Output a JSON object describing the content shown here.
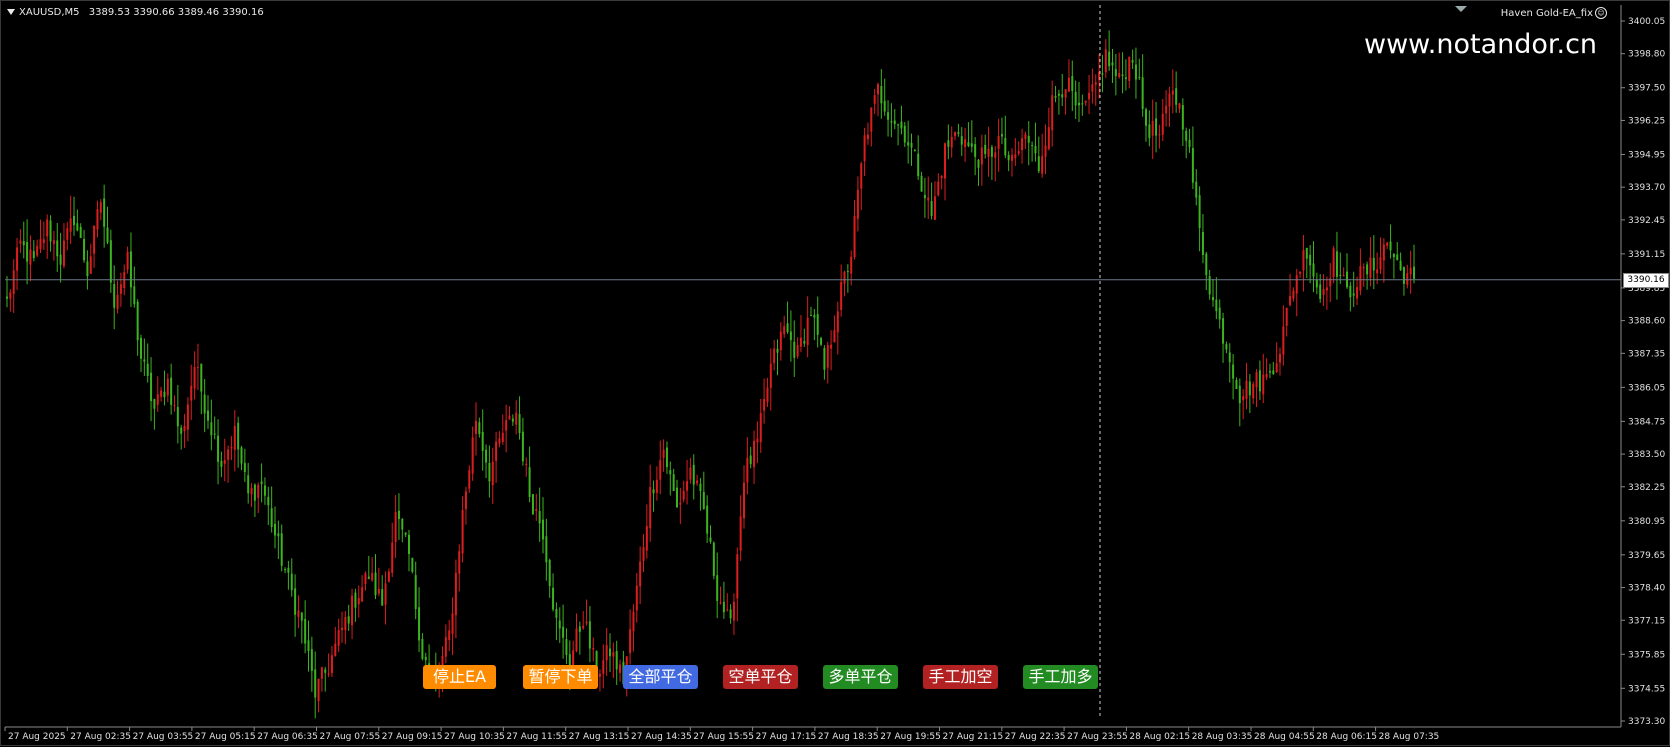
{
  "chart": {
    "symbol": "XAUUSD,M5",
    "ohlc": "3389.53 3390.66 3389.46 3390.16",
    "ea_label": "Haven Gold-EA_fix",
    "watermark": "www.notandor.cn",
    "current_price": "3390.16"
  },
  "buttons": [
    {
      "label": "停止EA",
      "color": "#ff8c00"
    },
    {
      "label": "暂停下单",
      "color": "#ff8c00"
    },
    {
      "label": "全部平仓",
      "color": "#4169e1"
    },
    {
      "label": "空单平仓",
      "color": "#b22222"
    },
    {
      "label": "多单平仓",
      "color": "#228b22"
    },
    {
      "label": "手工加空",
      "color": "#b22222"
    },
    {
      "label": "手工加多",
      "color": "#228b22"
    }
  ],
  "colors": {
    "bull": "#dc1e1e",
    "bear": "#3cb41e",
    "grid_line": "#6a7a8a",
    "axis_text": "#e0e0e0"
  },
  "chart_data": {
    "type": "candlestick",
    "x_tick_labels": [
      "27 Aug 2025",
      "27 Aug 02:35",
      "27 Aug 03:55",
      "27 Aug 05:15",
      "27 Aug 06:35",
      "27 Aug 07:55",
      "27 Aug 09:15",
      "27 Aug 10:35",
      "27 Aug 11:55",
      "27 Aug 13:15",
      "27 Aug 14:35",
      "27 Aug 15:55",
      "27 Aug 17:15",
      "27 Aug 18:35",
      "27 Aug 19:55",
      "27 Aug 21:15",
      "27 Aug 22:35",
      "27 Aug 23:55",
      "28 Aug 02:15",
      "28 Aug 03:35",
      "28 Aug 04:55",
      "28 Aug 06:15",
      "28 Aug 07:35"
    ],
    "y_tick_labels": [
      "3400.05",
      "3398.80",
      "3397.50",
      "3396.25",
      "3394.95",
      "3393.70",
      "3392.45",
      "3391.15",
      "3389.85",
      "3388.60",
      "3387.35",
      "3386.05",
      "3384.75",
      "3383.50",
      "3382.25",
      "3380.95",
      "3379.65",
      "3378.40",
      "3377.15",
      "3375.85",
      "3374.55",
      "3373.30"
    ],
    "ylim": [
      3373.3,
      3400.05
    ],
    "current_price": 3390.16,
    "close_path": [
      3389.3,
      3391.5,
      3390.8,
      3392.2,
      3391.0,
      3392.6,
      3390.5,
      3393.2,
      3389.4,
      3390.8,
      3387.2,
      3385.2,
      3386.3,
      3384.1,
      3386.9,
      3385.0,
      3383.2,
      3384.3,
      3381.9,
      3382.4,
      3380.4,
      3378.6,
      3377.0,
      3374.4,
      3375.4,
      3376.8,
      3378.0,
      3378.9,
      3377.8,
      3381.1,
      3379.6,
      3375.9,
      3374.7,
      3376.6,
      3381.2,
      3384.9,
      3382.8,
      3384.3,
      3385.1,
      3382.0,
      3380.6,
      3377.0,
      3375.6,
      3377.3,
      3375.1,
      3376.0,
      3374.9,
      3378.3,
      3382.0,
      3383.7,
      3381.4,
      3382.9,
      3381.3,
      3378.3,
      3376.8,
      3382.7,
      3383.9,
      3386.8,
      3388.3,
      3387.3,
      3389.0,
      3386.7,
      3389.2,
      3391.2,
      3395.5,
      3397.4,
      3396.4,
      3395.8,
      3394.4,
      3392.6,
      3395.1,
      3395.9,
      3395.0,
      3394.7,
      3395.5,
      3394.5,
      3395.7,
      3394.5,
      3396.9,
      3397.8,
      3396.4,
      3397.2,
      3398.7,
      3397.7,
      3398.8,
      3396.1,
      3395.6,
      3397.5,
      3395.9,
      3392.0,
      3389.3,
      3387.7,
      3385.8,
      3386.2,
      3386.4,
      3387.6,
      3390.0,
      3391.4,
      3389.5,
      3391.0,
      3389.6,
      3390.3,
      3390.7,
      3391.6,
      3390.5,
      3390.2
    ]
  }
}
